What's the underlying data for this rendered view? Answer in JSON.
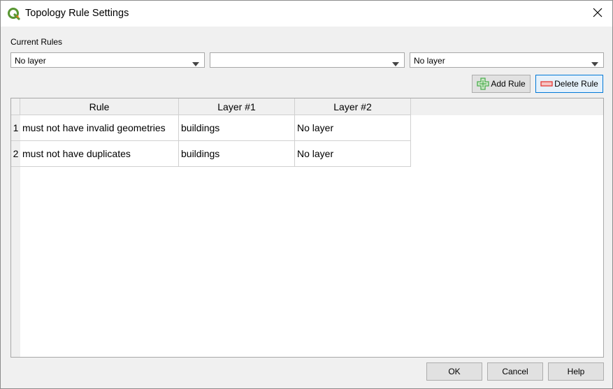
{
  "window": {
    "title": "Topology Rule Settings",
    "app_icon": "qgis-logo-icon",
    "close_icon": "close-icon"
  },
  "section_label": "Current Rules",
  "selectors": {
    "layer1": "No layer",
    "rule": "",
    "layer2": "No layer"
  },
  "actions": {
    "add_rule_label": "Add Rule",
    "add_rule_icon": "plus-icon",
    "delete_rule_label": "Delete Rule",
    "delete_rule_icon": "minus-icon"
  },
  "table": {
    "columns": [
      "Rule",
      "Layer #1",
      "Layer #2"
    ],
    "rows": [
      {
        "num": "1",
        "rule": "must not have invalid geometries",
        "layer1": "buildings",
        "layer2": "No layer"
      },
      {
        "num": "2",
        "rule": "must not have duplicates",
        "layer1": "buildings",
        "layer2": "No layer"
      }
    ]
  },
  "footer": {
    "ok_label": "OK",
    "cancel_label": "Cancel",
    "help_label": "Help"
  },
  "colors": {
    "add_icon_green": "#4caf50",
    "delete_icon_red": "#e53935",
    "focus_blue": "#0078d7",
    "qgis_green": "#589632",
    "qgis_yellow": "#ee7913"
  }
}
